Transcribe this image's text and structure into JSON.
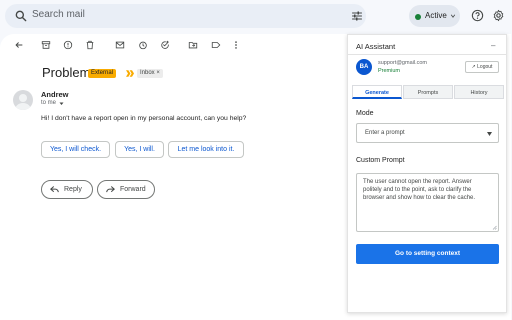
{
  "search": {
    "placeholder": "Search mail"
  },
  "status": {
    "label": "Active",
    "color": "#188038"
  },
  "toolbar": {
    "icons": [
      "back-arrow-icon",
      "archive-icon",
      "report-spam-icon",
      "delete-icon",
      "mark-unread-icon",
      "snooze-icon",
      "add-task-icon",
      "move-to-icon",
      "label-icon",
      "more-vert-icon"
    ]
  },
  "email": {
    "subject": "Problem",
    "label_external": "External",
    "label_inbox": "Inbox",
    "label_inbox_remove": "×",
    "sender": "Andrew",
    "to": "to me",
    "body": "Hi! I don't have a report open in my personal account, can you help?"
  },
  "smart_replies": [
    "Yes, I will check.",
    "Yes, I will.",
    "Let me look into it."
  ],
  "actions": {
    "reply": "Reply",
    "forward": "Forward"
  },
  "ai_panel": {
    "title": "AI Assistant",
    "minimize": "–",
    "avatar_initials": "BA",
    "account_email": "support@gmail.com",
    "account_plan": "Premium",
    "logout_label": "Logout",
    "tabs": [
      {
        "label": "Generate",
        "active": true
      },
      {
        "label": "Prompts",
        "active": false
      },
      {
        "label": "History",
        "active": false
      }
    ],
    "mode_label": "Mode",
    "mode_placeholder": "Enter a prompt",
    "custom_prompt_label": "Custom Prompt",
    "custom_prompt_text": "The user cannot open the report. Answer politely and to the point, ask to clarify the browser and show how to clear the cache.",
    "submit_label": "Go to setting context",
    "accent": "#1a73e8"
  }
}
